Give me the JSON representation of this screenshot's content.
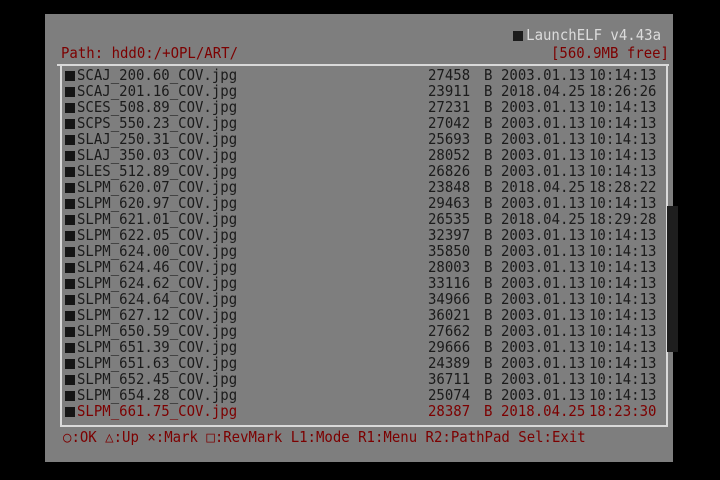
{
  "app": {
    "title": "LaunchELF v4.43a",
    "path": "Path: hdd0:/+OPL/ART/",
    "free_space": "[560.9MB free]"
  },
  "file_list": {
    "columns": [
      "name",
      "size",
      "unit",
      "date",
      "time"
    ],
    "rows": [
      {
        "name": "SCAJ_200.60_COV.jpg",
        "size": "27458",
        "unit": "B",
        "date": "2003.01.13",
        "time": "10:14:13",
        "selected": false
      },
      {
        "name": "SCAJ_201.16_COV.jpg",
        "size": "23911",
        "unit": "B",
        "date": "2018.04.25",
        "time": "18:26:26",
        "selected": false
      },
      {
        "name": "SCES_508.89_COV.jpg",
        "size": "27231",
        "unit": "B",
        "date": "2003.01.13",
        "time": "10:14:13",
        "selected": false
      },
      {
        "name": "SCPS_550.23_COV.jpg",
        "size": "27042",
        "unit": "B",
        "date": "2003.01.13",
        "time": "10:14:13",
        "selected": false
      },
      {
        "name": "SLAJ_250.31_COV.jpg",
        "size": "25693",
        "unit": "B",
        "date": "2003.01.13",
        "time": "10:14:13",
        "selected": false
      },
      {
        "name": "SLAJ_350.03_COV.jpg",
        "size": "28052",
        "unit": "B",
        "date": "2003.01.13",
        "time": "10:14:13",
        "selected": false
      },
      {
        "name": "SLES_512.89_COV.jpg",
        "size": "26826",
        "unit": "B",
        "date": "2003.01.13",
        "time": "10:14:13",
        "selected": false
      },
      {
        "name": "SLPM_620.07_COV.jpg",
        "size": "23848",
        "unit": "B",
        "date": "2018.04.25",
        "time": "18:28:22",
        "selected": false
      },
      {
        "name": "SLPM_620.97_COV.jpg",
        "size": "29463",
        "unit": "B",
        "date": "2003.01.13",
        "time": "10:14:13",
        "selected": false
      },
      {
        "name": "SLPM_621.01_COV.jpg",
        "size": "26535",
        "unit": "B",
        "date": "2018.04.25",
        "time": "18:29:28",
        "selected": false
      },
      {
        "name": "SLPM_622.05_COV.jpg",
        "size": "32397",
        "unit": "B",
        "date": "2003.01.13",
        "time": "10:14:13",
        "selected": false
      },
      {
        "name": "SLPM_624.00_COV.jpg",
        "size": "35850",
        "unit": "B",
        "date": "2003.01.13",
        "time": "10:14:13",
        "selected": false
      },
      {
        "name": "SLPM_624.46_COV.jpg",
        "size": "28003",
        "unit": "B",
        "date": "2003.01.13",
        "time": "10:14:13",
        "selected": false
      },
      {
        "name": "SLPM_624.62_COV.jpg",
        "size": "33116",
        "unit": "B",
        "date": "2003.01.13",
        "time": "10:14:13",
        "selected": false
      },
      {
        "name": "SLPM_624.64_COV.jpg",
        "size": "34966",
        "unit": "B",
        "date": "2003.01.13",
        "time": "10:14:13",
        "selected": false
      },
      {
        "name": "SLPM_627.12_COV.jpg",
        "size": "36021",
        "unit": "B",
        "date": "2003.01.13",
        "time": "10:14:13",
        "selected": false
      },
      {
        "name": "SLPM_650.59_COV.jpg",
        "size": "27662",
        "unit": "B",
        "date": "2003.01.13",
        "time": "10:14:13",
        "selected": false
      },
      {
        "name": "SLPM_651.39_COV.jpg",
        "size": "29666",
        "unit": "B",
        "date": "2003.01.13",
        "time": "10:14:13",
        "selected": false
      },
      {
        "name": "SLPM_651.63_COV.jpg",
        "size": "24389",
        "unit": "B",
        "date": "2003.01.13",
        "time": "10:14:13",
        "selected": false
      },
      {
        "name": "SLPM_652.45_COV.jpg",
        "size": "36711",
        "unit": "B",
        "date": "2003.01.13",
        "time": "10:14:13",
        "selected": false
      },
      {
        "name": "SLPM_654.28_COV.jpg",
        "size": "25074",
        "unit": "B",
        "date": "2003.01.13",
        "time": "10:14:13",
        "selected": false
      },
      {
        "name": "SLPM_661.75_COV.jpg",
        "size": "28387",
        "unit": "B",
        "date": "2018.04.25",
        "time": "18:23:30",
        "selected": true
      }
    ]
  },
  "help_bar": {
    "ok": ":OK",
    "up": ":Up",
    "mark": ":Mark",
    "revmark": ":RevMark",
    "rest": "L1:Mode R1:Menu R2:PathPad Sel:Exit"
  },
  "colors": {
    "background": "#7e7e7e",
    "text": "#1b1b1b",
    "accent": "#7c0000",
    "frame": "#d9d9d9"
  },
  "icons": [
    "file-icon",
    "circle-button-icon",
    "triangle-button-icon",
    "cross-button-icon",
    "square-button-icon"
  ]
}
